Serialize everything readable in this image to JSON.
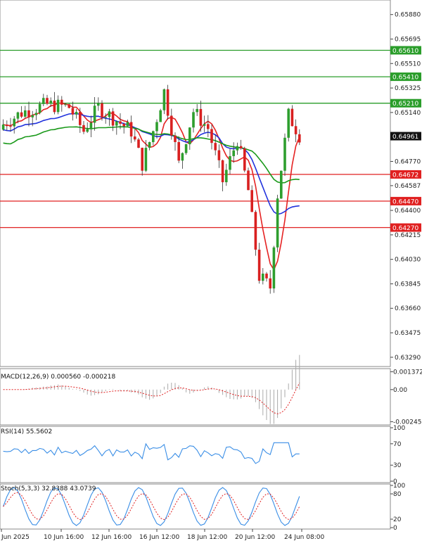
{
  "chart_data": {
    "type": "candlestick",
    "main": {
      "y_ticks": [
        "0.65880",
        "0.65695",
        "0.65510",
        "0.65325",
        "0.65140",
        "0.64955",
        "0.64770",
        "0.64587",
        "0.64400",
        "0.64215",
        "0.64030",
        "0.63845",
        "0.63660",
        "0.63475",
        "0.63290"
      ],
      "ylim": [
        0.6322,
        0.6599
      ],
      "current_price": "0.64961",
      "resistance_levels": [
        "0.65610",
        "0.65410",
        "0.65210"
      ],
      "support_levels": [
        "0.64672",
        "0.64470",
        "0.64270"
      ],
      "colors": {
        "resistance": "#2a9d2a",
        "support": "#e02020",
        "bull": "#2e9e2e",
        "bear": "#d92020",
        "ma_fast": "#e52222",
        "ma_mid": "#2233dd",
        "ma_slow": "#199919"
      }
    },
    "x_labels": [
      "Jun 2025",
      "10 Jun 16:00",
      "12 Jun 16:00",
      "16 Jun 12:00",
      "18 Jun 12:00",
      "20 Jun 12:00",
      "24 Jun 08:00"
    ],
    "macd": {
      "label": "MACD(12,26,9) 0.000560 -0.000218",
      "ticks": [
        "0.001372",
        "0.00",
        "-0.002459"
      ],
      "ylim": [
        -0.0026,
        0.0015
      ]
    },
    "rsi": {
      "label": "RSI(14) 55.5602",
      "ticks": [
        "100",
        "70",
        "30",
        "0"
      ],
      "ylim": [
        0,
        100
      ]
    },
    "stoch": {
      "label": "Stoch(5,3,3) 32.8388 43.0739",
      "ticks": [
        "100",
        "80",
        "20",
        "0"
      ],
      "ylim": [
        0,
        100
      ]
    }
  }
}
